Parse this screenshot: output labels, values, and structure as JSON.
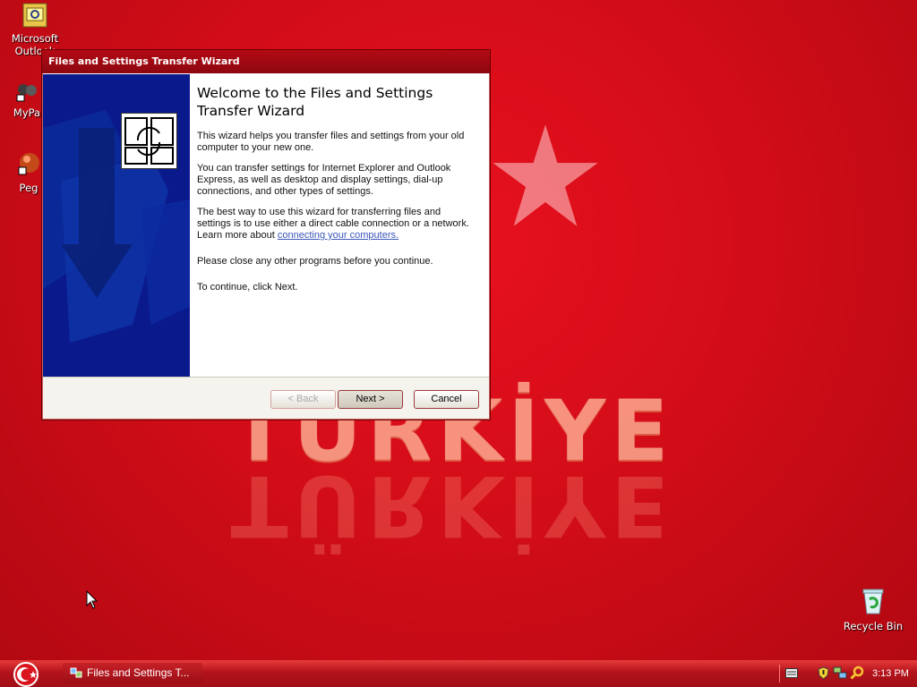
{
  "desktop": {
    "icons": [
      {
        "label": "Microsoft Outlook",
        "icon": "outlook-icon"
      },
      {
        "label": "MyPa",
        "icon": "mypc-icon"
      },
      {
        "label": "Peg",
        "icon": "pegasus-icon"
      },
      {
        "label": "Recycle Bin",
        "icon": "recycle-bin-icon"
      }
    ],
    "wallpaper_text": "TÜRKİYE"
  },
  "window": {
    "title": "Files and Settings Transfer Wizard",
    "heading": "Welcome to the Files and Settings Transfer Wizard",
    "paragraphs": [
      "This wizard helps you transfer files and settings from your old computer to your new one.",
      "You can transfer settings for Internet Explorer and Outlook Express, as well as desktop and display settings, dial-up connections, and other types of settings.",
      "The best way to use this wizard for transferring files and settings is to use either a direct cable connection or a network. Learn more about",
      "Please close any other programs before you continue.",
      "To continue, click Next."
    ],
    "link_text": "connecting your computers.",
    "buttons": {
      "back": "< Back",
      "next": "Next >",
      "cancel": "Cancel"
    }
  },
  "taskbar": {
    "task_label": "Files and Settings T...",
    "clock": "3:13 PM"
  },
  "colors": {
    "desktop_red": "#d20d18",
    "titlebar": "#a50912",
    "wizard_side": "#0a1a8c",
    "taskbar": "#b3121a"
  }
}
